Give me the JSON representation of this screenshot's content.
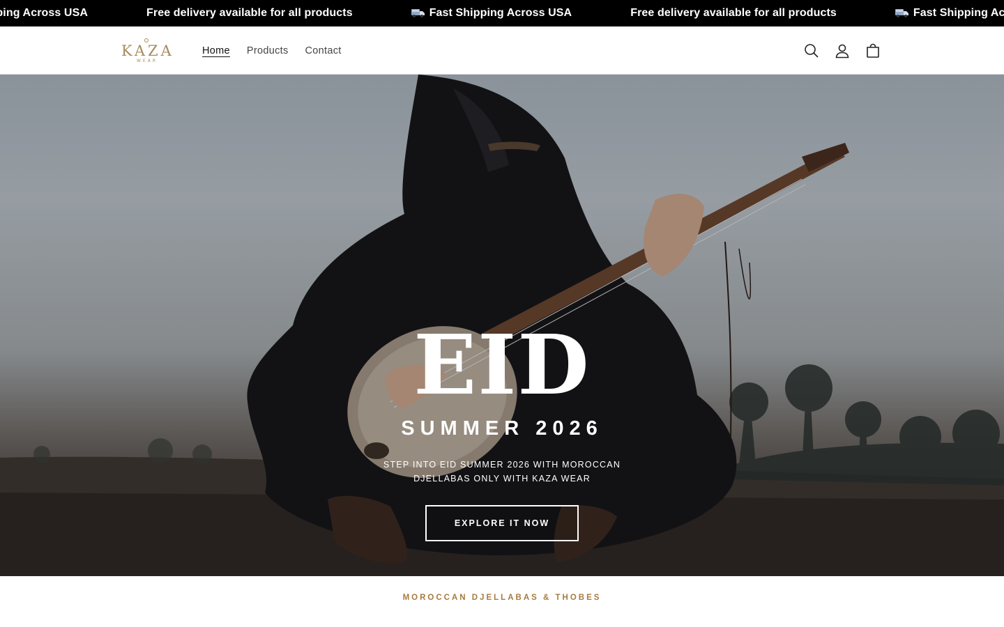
{
  "announcement": {
    "items": [
      {
        "text": "ipping Across USA",
        "icon": ""
      },
      {
        "text": "Free delivery available for all products",
        "icon": ""
      },
      {
        "text": "Fast Shipping Across USA",
        "icon": "truck-icon"
      },
      {
        "text": "Free delivery available for all products",
        "icon": ""
      },
      {
        "text": "Fast Shipping Across U",
        "icon": "truck-icon"
      }
    ]
  },
  "header": {
    "logo_text": "KAZA",
    "logo_subtext": "WEAR",
    "nav": [
      {
        "label": "Home",
        "active": true
      },
      {
        "label": "Products",
        "active": false
      },
      {
        "label": "Contact",
        "active": false
      }
    ],
    "icons": [
      "search-icon",
      "account-icon",
      "cart-icon"
    ]
  },
  "hero": {
    "title": "EID",
    "subtitle": "SUMMER 2026",
    "tagline": "STEP INTO EID SUMMER 2026 WITH MOROCCAN DJELLABAS ONLY WITH KAZA WEAR",
    "cta_label": "EXPLORE IT NOW"
  },
  "section": {
    "heading": "MOROCCAN DJELLABAS & THOBES"
  },
  "colors": {
    "announce_bg": "#000000",
    "accent": "#a97a3e",
    "logo": "#a88a5a"
  }
}
